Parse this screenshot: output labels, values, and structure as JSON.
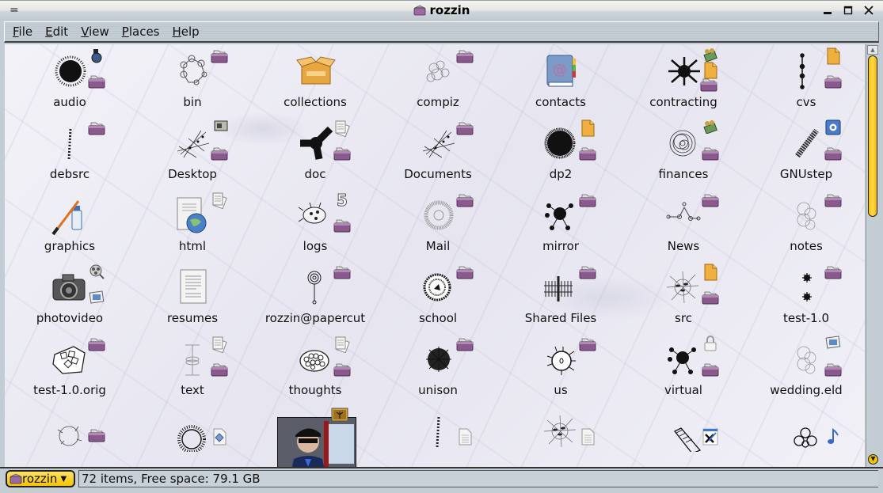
{
  "window": {
    "title": "rozzin",
    "menu_button": "=",
    "controls": {
      "minimize": "minimize",
      "maximize": "maximize",
      "close": "close"
    }
  },
  "menubar": {
    "items": [
      {
        "label": "File",
        "mnemonic": "F",
        "rest": "ile"
      },
      {
        "label": "Edit",
        "mnemonic": "E",
        "rest": "dit"
      },
      {
        "label": "View",
        "mnemonic": "V",
        "rest": "iew"
      },
      {
        "label": "Places",
        "mnemonic": "P",
        "rest": "laces"
      },
      {
        "label": "Help",
        "mnemonic": "H",
        "rest": "elp"
      }
    ]
  },
  "files": [
    {
      "name": "audio",
      "icon": "virus-blob",
      "emblems": [
        "music-player",
        "folder"
      ]
    },
    {
      "name": "bin",
      "icon": "ring-graph",
      "emblems": [
        "folder"
      ]
    },
    {
      "name": "collections",
      "icon": "open-box",
      "emblems": []
    },
    {
      "name": "compiz",
      "icon": "grey-scribble",
      "emblems": [
        "folder"
      ]
    },
    {
      "name": "contacts",
      "icon": "address-book",
      "emblems": []
    },
    {
      "name": "contracting",
      "icon": "black-fractal",
      "emblems": [
        "money",
        "document-orange",
        "folder"
      ]
    },
    {
      "name": "cvs",
      "icon": "vertical-chain",
      "emblems": [
        "document-orange",
        "folder"
      ]
    },
    {
      "name": "debsrc",
      "icon": "dotted-line",
      "emblems": [
        "folder"
      ]
    },
    {
      "name": "Desktop",
      "icon": "star-web",
      "emblems": [
        "desktop-picture",
        "folder"
      ]
    },
    {
      "name": "doc",
      "icon": "tri-blob",
      "emblems": [
        "papers",
        "folder"
      ]
    },
    {
      "name": "Documents",
      "icon": "star-web",
      "emblems": [
        "folder"
      ]
    },
    {
      "name": "dp2",
      "icon": "fuzzy-ball",
      "emblems": [
        "document-orange",
        "folder"
      ]
    },
    {
      "name": "finances",
      "icon": "scribble-ball",
      "emblems": [
        "money",
        "folder"
      ]
    },
    {
      "name": "GNUstep",
      "icon": "spring",
      "emblems": [
        "gear",
        "folder"
      ]
    },
    {
      "name": "graphics",
      "icon": "paint-brush",
      "emblems": []
    },
    {
      "name": "html",
      "icon": "web-page",
      "emblems": [
        "papers"
      ]
    },
    {
      "name": "logs",
      "icon": "spiky-cell",
      "emblems": [
        "number-5",
        "folder"
      ]
    },
    {
      "name": "Mail",
      "icon": "radial-sphere",
      "emblems": [
        "folder"
      ]
    },
    {
      "name": "mirror",
      "icon": "dendrite",
      "emblems": [
        "folder"
      ]
    },
    {
      "name": "News",
      "icon": "node-graph",
      "emblems": [
        "folder"
      ]
    },
    {
      "name": "notes",
      "icon": "grey-cluster",
      "emblems": [
        "folder"
      ]
    },
    {
      "name": "photovideo",
      "icon": "camera",
      "emblems": [
        "film-reel",
        "photo"
      ]
    },
    {
      "name": "resumes",
      "icon": "text-page",
      "emblems": []
    },
    {
      "name": "rozzin@papercut",
      "icon": "spiral-pin",
      "emblems": [
        "folder"
      ]
    },
    {
      "name": "school",
      "icon": "round-seal",
      "emblems": [
        "folder"
      ]
    },
    {
      "name": "Shared Files",
      "icon": "barcode-stack",
      "emblems": [
        "folder"
      ]
    },
    {
      "name": "src",
      "icon": "spider-web",
      "emblems": [
        "document-orange",
        "folder"
      ]
    },
    {
      "name": "test-1.0",
      "icon": "two-stars",
      "emblems": [
        "folder"
      ]
    },
    {
      "name": "test-1.0.orig",
      "icon": "dice-bag",
      "emblems": [
        "folder"
      ]
    },
    {
      "name": "text",
      "icon": "i-beam",
      "emblems": [
        "papers",
        "folder"
      ]
    },
    {
      "name": "thoughts",
      "icon": "cell-cluster",
      "emblems": [
        "papers",
        "folder"
      ]
    },
    {
      "name": "unison",
      "icon": "dense-scribble",
      "emblems": [
        "folder"
      ]
    },
    {
      "name": "us",
      "icon": "hairy-cell",
      "emblems": [
        "folder"
      ]
    },
    {
      "name": "virtual",
      "icon": "dendrite",
      "emblems": [
        "lock",
        "folder"
      ]
    },
    {
      "name": "wedding.eld",
      "icon": "grey-cluster",
      "emblems": [
        "photo",
        "folder"
      ]
    },
    {
      "name": "",
      "icon": "sparkle-ring",
      "emblems": [
        "folder"
      ]
    },
    {
      "name": "",
      "icon": "sun-ring",
      "emblems": [
        "diamond-doc"
      ]
    },
    {
      "name": "",
      "icon": "photo",
      "emblems": [
        "picture-frame"
      ]
    },
    {
      "name": "",
      "icon": "dotted-line",
      "emblems": [
        "text-doc"
      ]
    },
    {
      "name": "",
      "icon": "spider-web",
      "emblems": [
        "text-doc"
      ]
    },
    {
      "name": "",
      "icon": "mesh-tube",
      "emblems": [
        "x-doc"
      ]
    },
    {
      "name": "",
      "icon": "flower-knot",
      "emblems": [
        "music-note"
      ]
    }
  ],
  "statusbar": {
    "location": "rozzin",
    "info": "72 items, Free space: 79.1 GB"
  },
  "scrollbar": {
    "position_fraction": 0.0,
    "visible_fraction": 0.39
  },
  "colors": {
    "accent": "#f5c400",
    "folder_emblem": "#8a5a8e",
    "background": "#ecebf4"
  }
}
